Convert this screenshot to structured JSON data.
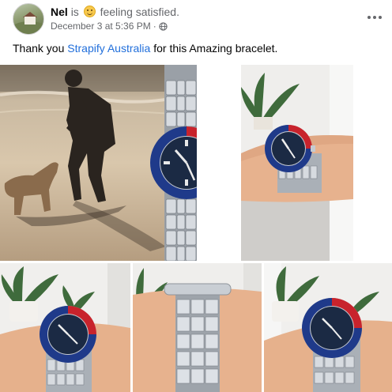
{
  "post": {
    "author": "Nel",
    "activity_prefix": "is",
    "feeling": "feeling satisfied.",
    "feeling_icon": "slightly-smiling-face-emoji",
    "timestamp": "December 3 at 5:36 PM",
    "separator": "·",
    "audience_icon": "globe-icon",
    "more_icon": "more-options-icon",
    "text_before": "Thank you ",
    "mention": "Strapify Australia",
    "text_after": " for this Amazing bracelet."
  },
  "photos": [
    {
      "name": "photo-beach-watch",
      "description_icon": "image"
    },
    {
      "name": "photo-wrist-side",
      "description_icon": "image"
    },
    {
      "name": "photo-wrist-left",
      "description_icon": "image"
    },
    {
      "name": "photo-bracelet-underside",
      "description_icon": "image"
    },
    {
      "name": "photo-wrist-right",
      "description_icon": "image"
    }
  ],
  "colors": {
    "link": "#216fdb",
    "secondary_text": "#65676b",
    "pepsi_red": "#c8232c",
    "pepsi_blue": "#1f3a8a",
    "dial": "#1b2a44",
    "steel": "#b9bec5"
  }
}
